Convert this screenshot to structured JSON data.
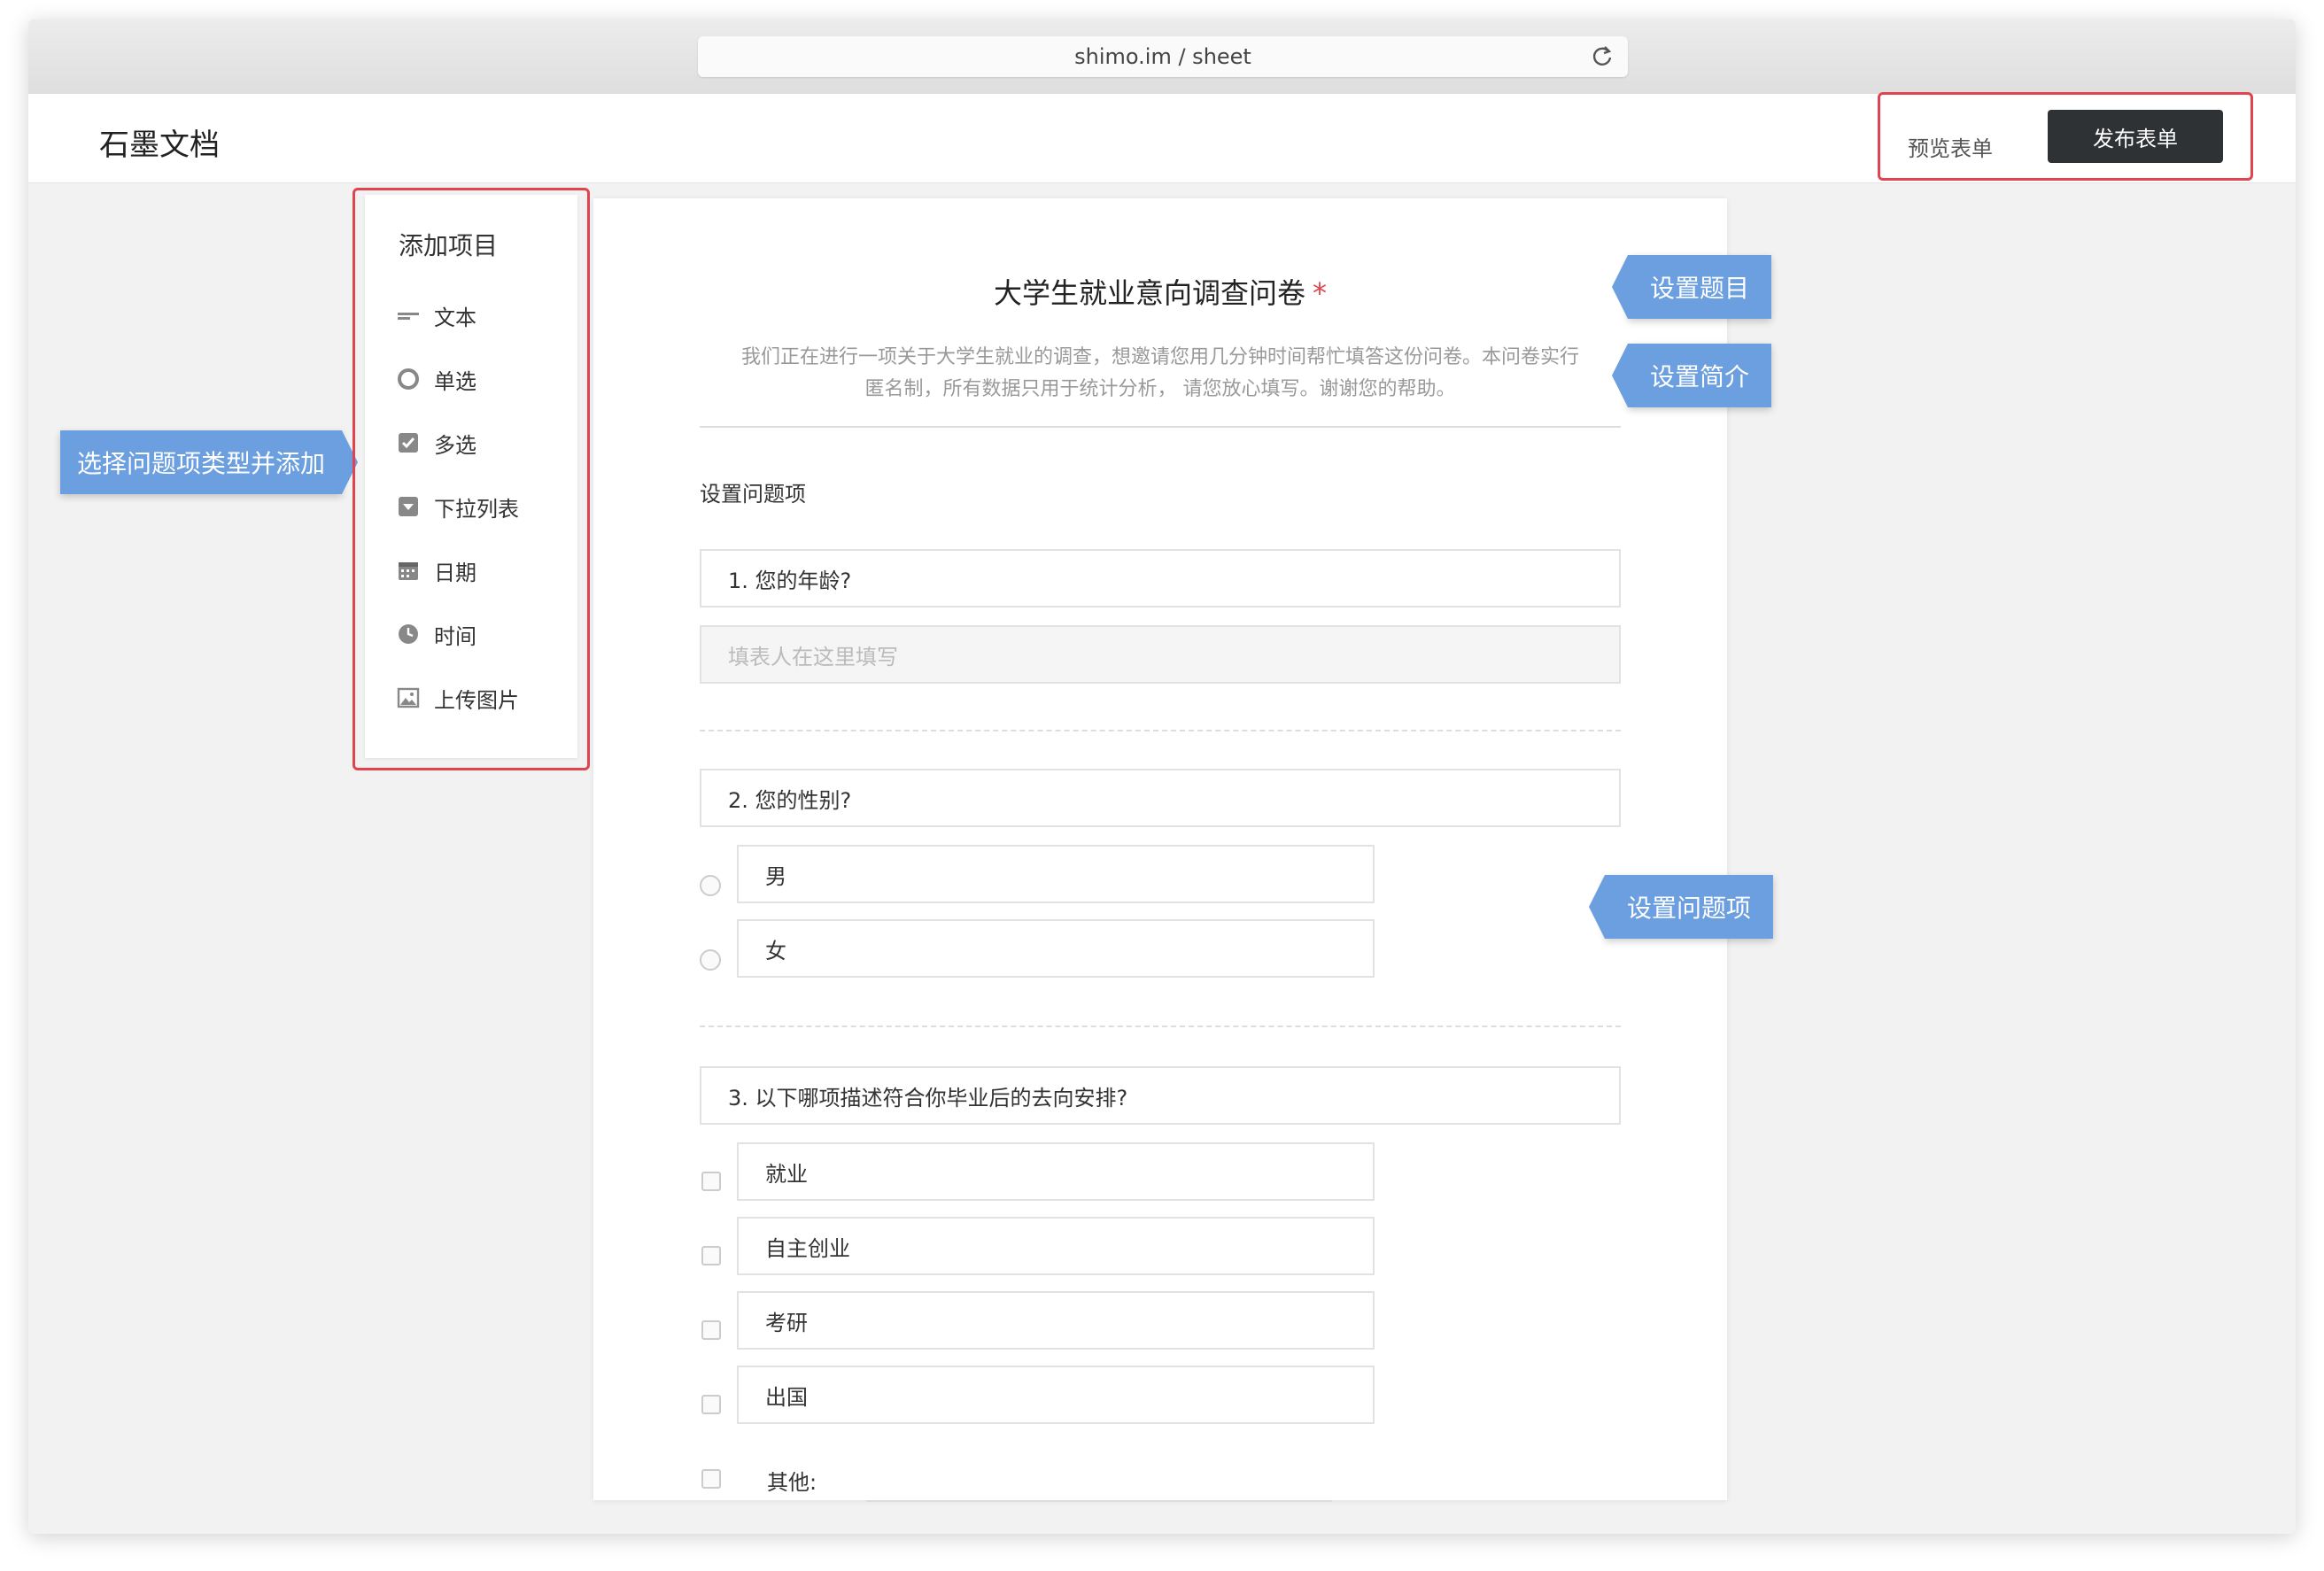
{
  "browser": {
    "url": "shimo.im / sheet"
  },
  "app": {
    "logo": "石墨文档",
    "preview_label": "预览表单",
    "publish_label": "发布表单"
  },
  "sidebar": {
    "title": "添加项目",
    "items": [
      {
        "label": "文本",
        "icon": "text-icon"
      },
      {
        "label": "单选",
        "icon": "radio-icon"
      },
      {
        "label": "多选",
        "icon": "checkbox-icon"
      },
      {
        "label": "下拉列表",
        "icon": "dropdown-icon"
      },
      {
        "label": "日期",
        "icon": "calendar-icon"
      },
      {
        "label": "时间",
        "icon": "clock-icon"
      },
      {
        "label": "上传图片",
        "icon": "image-icon"
      }
    ]
  },
  "callouts": {
    "add_type": "选择问题项类型并添加",
    "set_title": "设置题目",
    "set_desc": "设置简介",
    "set_question": "设置问题项"
  },
  "form": {
    "title": "大学生就业意向调查问卷",
    "required_mark": "*",
    "description_line1": "我们正在进行一项关于大学生就业的调查，想邀请您用几分钟时间帮忙填答这份问卷。本问卷实行",
    "description_line2": "匿名制，所有数据只用于统计分析，  请您放心填写。谢谢您的帮助。",
    "section_label": "设置问题项",
    "q1": {
      "title": "1. 您的年龄?",
      "placeholder": "填表人在这里填写"
    },
    "q2": {
      "title": "2. 您的性别?",
      "options": [
        "男",
        "女"
      ]
    },
    "q3": {
      "title": "3. 以下哪项描述符合你毕业后的去向安排?",
      "options": [
        "就业",
        "自主创业",
        "考研",
        "出国"
      ],
      "other_label": "其他:"
    }
  },
  "colors": {
    "accent_blue": "#6b9fdf",
    "highlight_red": "#e0444f",
    "publish_bg": "#2f3235"
  }
}
